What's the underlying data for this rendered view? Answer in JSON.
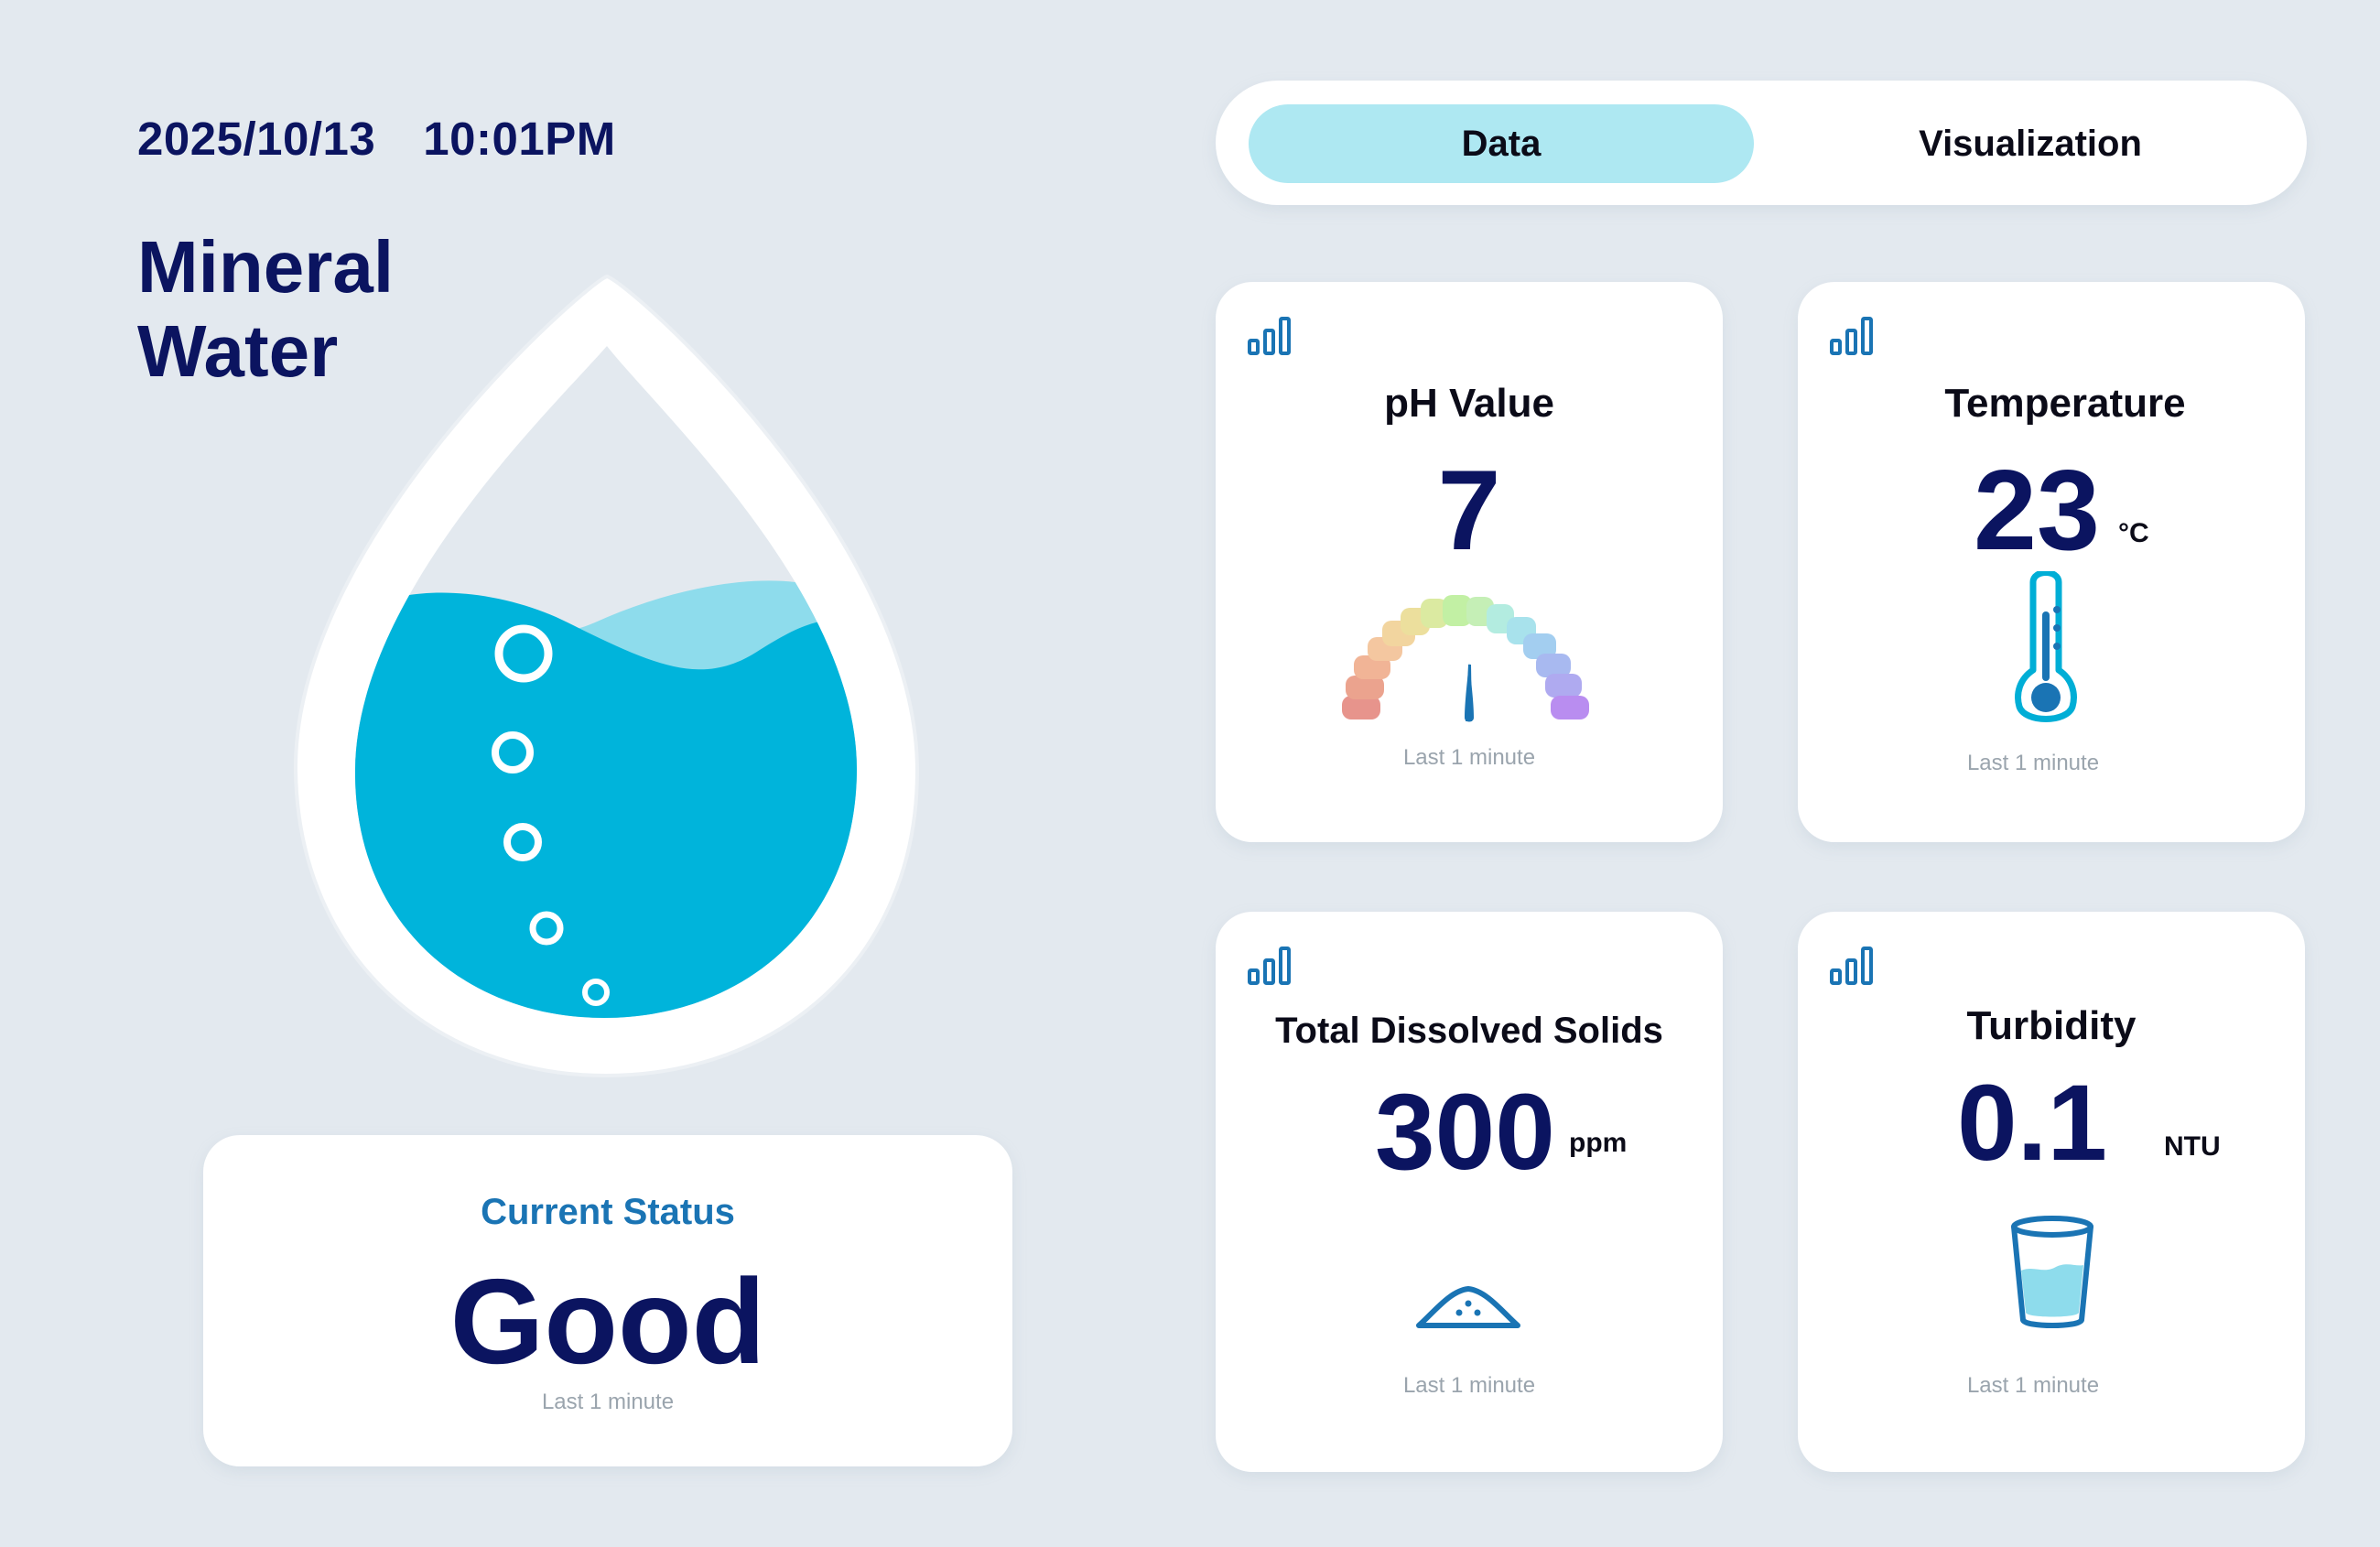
{
  "header": {
    "date": "2025/10/13",
    "time": "10:01PM",
    "title_line1": "Mineral",
    "title_line2": "Water"
  },
  "tabs": [
    {
      "label": "Data",
      "active": true
    },
    {
      "label": "Visualization",
      "active": false
    }
  ],
  "status": {
    "label": "Current Status",
    "value": "Good",
    "footnote": "Last 1 minute"
  },
  "metrics": {
    "ph": {
      "title": "pH Value",
      "value": "7",
      "footnote": "Last 1 minute",
      "icon": "ph-gauge-icon"
    },
    "temperature": {
      "title": "Temperature",
      "value": "23",
      "unit": "°C",
      "footnote": "Last 1 minute",
      "icon": "thermometer-icon"
    },
    "tds": {
      "title": "Total Dissolved Solids",
      "value": "300",
      "unit": "ppm",
      "footnote": "Last 1 minute",
      "icon": "sediment-pile-icon"
    },
    "turbidity": {
      "title": "Turbidity",
      "value": "0.1",
      "unit": "NTU",
      "footnote": "Last 1 minute",
      "icon": "water-glass-icon"
    }
  },
  "colors": {
    "background": "#e3e9ef",
    "navy": "#0b1460",
    "accent_blue": "#1a74b4",
    "water": "#00b4db",
    "water_light": "#8edcec",
    "active_tab": "#aee8f2"
  },
  "icons": {
    "card_chart": "bar-chart-icon",
    "drop": "water-drop-icon",
    "bubbles": "bubble-icon"
  }
}
